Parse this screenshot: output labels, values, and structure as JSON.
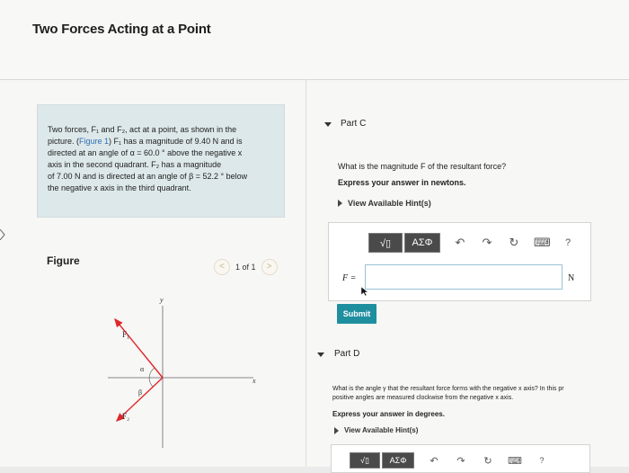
{
  "page": {
    "title": "Two Forces Acting at a Point"
  },
  "problem": {
    "line1": "Two forces, F₁ and F₂, act at a point, as shown in the",
    "line2_pre": "picture. (",
    "figure_link": "Figure 1",
    "line2_post": ") F₁ has a magnitude of 9.40 N and is",
    "line3": "directed at an angle of α = 60.0 ° above the negative x",
    "line4": "axis in the second quadrant. F₂ has a magnitude",
    "line5": "of 7.00 N and is directed at an angle of β = 52.2 ° below",
    "line6": "the negative x axis in the third quadrant."
  },
  "figure": {
    "label": "Figure",
    "pager": "1 of 1",
    "prev_icon": "<",
    "next_icon": ">",
    "axis_y": "y",
    "axis_x": "x",
    "f1_label": "F₁",
    "f2_label": "F₂",
    "alpha": "α",
    "beta": "β"
  },
  "partC": {
    "title": "Part C",
    "question": "What is the magnitude F of the resultant force?",
    "instruction": "Express your answer in newtons.",
    "hints": "View Available Hint(s)",
    "toolbar": {
      "templates": "√▯",
      "greek": "ΑΣΦ",
      "help": "?"
    },
    "var_label": "F =",
    "input_value": "",
    "unit": "N",
    "submit": "Submit"
  },
  "partD": {
    "title": "Part D",
    "question": "What is the angle γ that the resultant force forms with the negative x axis? In this pr",
    "question2": "positive angles are measured clockwise from the negative x axis.",
    "instruction": "Express your answer in degrees.",
    "hints": "View Available Hint(s)",
    "toolbar": {
      "templates": "√▯",
      "greek": "ΑΣΦ",
      "help": "?"
    }
  },
  "colors": {
    "accent": "#1f8fa0",
    "link": "#2f6fb3",
    "problem_bg": "#dde8ea",
    "arrow": "#e0262a"
  }
}
